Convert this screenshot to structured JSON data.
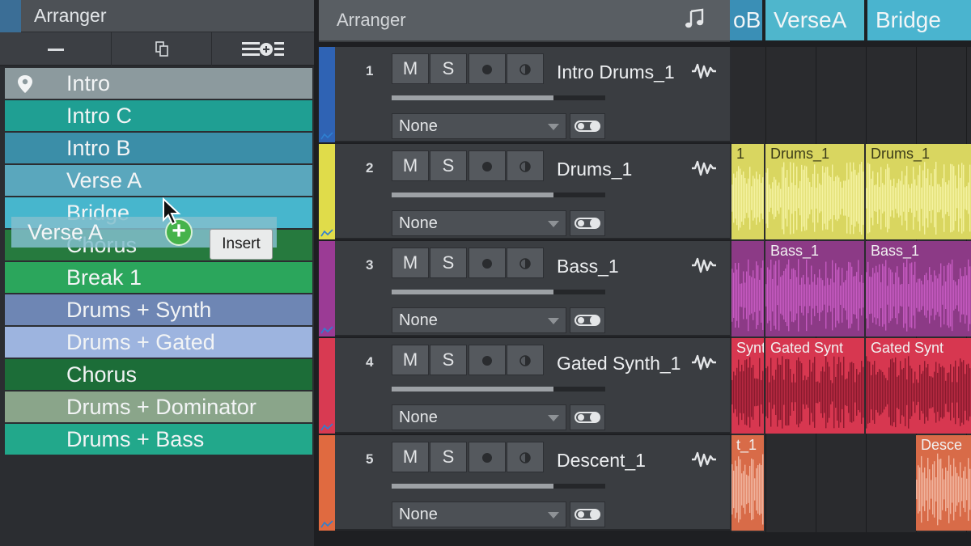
{
  "left_panel": {
    "title": "Arranger",
    "toolbar": {
      "remove_label": "remove",
      "duplicate_label": "duplicate",
      "add_label": "add"
    },
    "sections": [
      {
        "label": "Intro",
        "color": "#8c9a9e",
        "pinned": true
      },
      {
        "label": "Intro C",
        "color": "#1f9f93"
      },
      {
        "label": "Intro B",
        "color": "#3b8ea8"
      },
      {
        "label": "Verse A",
        "color": "#5aa7bd"
      },
      {
        "label": "Bridge",
        "color": "#47b6cd"
      },
      {
        "label": "Chorus",
        "color": "#267a3e"
      },
      {
        "label": "Break 1",
        "color": "#2ba65c"
      },
      {
        "label": "Drums + Synth",
        "color": "#6e86b4"
      },
      {
        "label": "Drums + Gated",
        "color": "#9db4df"
      },
      {
        "label": "Chorus",
        "color": "#1c6d38"
      },
      {
        "label": "Drums + Dominator",
        "color": "#8aa58a"
      },
      {
        "label": "Drums + Bass",
        "color": "#22a88b"
      }
    ],
    "drag": {
      "label": "Verse A",
      "tooltip": "Insert"
    }
  },
  "arranger": {
    "title": "Arranger",
    "header_sections": [
      {
        "label": "oB",
        "color": "#3a8fb6"
      },
      {
        "label": "VerseA",
        "color": "#4fb6cc"
      },
      {
        "label": "Bridge",
        "color": "#4ab4cf"
      }
    ]
  },
  "tracks": [
    {
      "number": "1",
      "name": "Intro Drums_1",
      "mute": "M",
      "solo": "S",
      "input": "None",
      "color": "#2f63b4",
      "clip_color": "#2a2b2e",
      "clips": []
    },
    {
      "number": "2",
      "name": "Drums_1",
      "mute": "M",
      "solo": "S",
      "input": "None",
      "color": "#e0dc4a",
      "clip_color": "#d9d660",
      "clips": [
        "1",
        "Drums_1",
        "Drums_1"
      ]
    },
    {
      "number": "3",
      "name": "Bass_1",
      "mute": "M",
      "solo": "S",
      "input": "None",
      "color": "#9b3b95",
      "clip_color": "#8c3a86",
      "clips": [
        "",
        "Bass_1",
        "Bass_1"
      ]
    },
    {
      "number": "4",
      "name": "Gated Synth_1",
      "mute": "M",
      "solo": "S",
      "input": "None",
      "color": "#d83a52",
      "clip_color": "#d73750",
      "clips": [
        "Synt",
        "Gated Synt",
        "Gated Synt"
      ]
    },
    {
      "number": "5",
      "name": "Descent_1",
      "mute": "M",
      "solo": "S",
      "input": "None",
      "color": "#e06a40",
      "clip_color": "#d86b48",
      "clips": [
        "t_1",
        "Desce"
      ]
    }
  ]
}
